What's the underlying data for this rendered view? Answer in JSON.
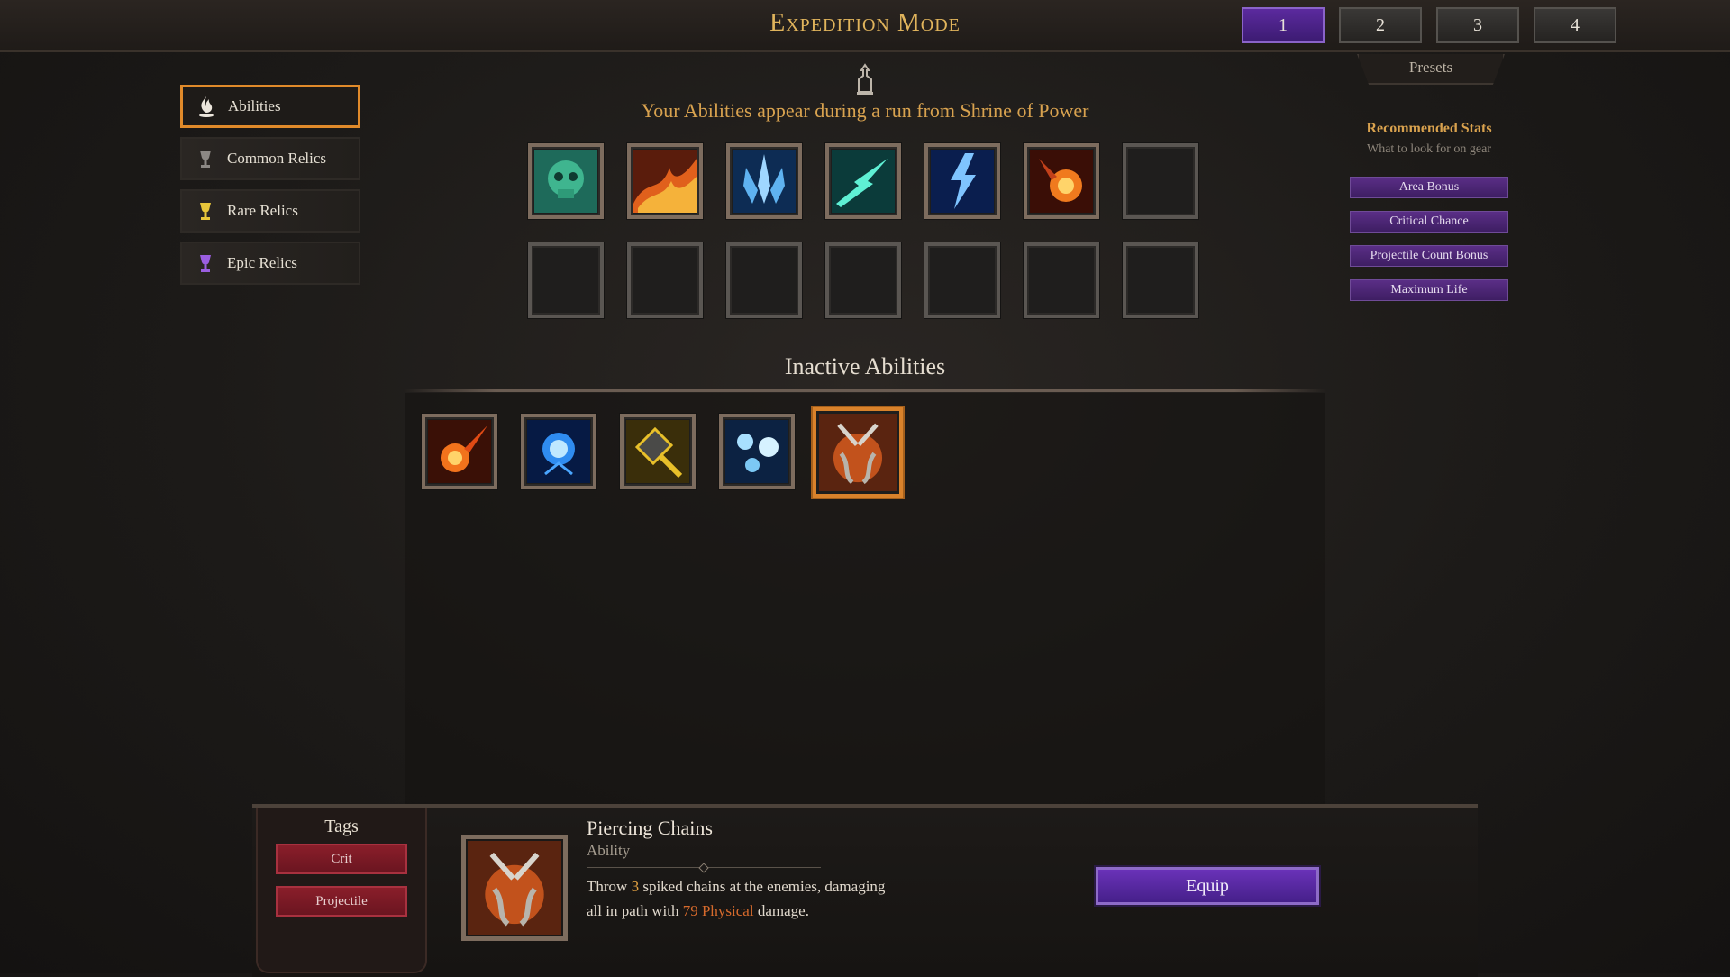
{
  "header": {
    "title": "Expedition Mode",
    "preset_buttons": [
      "1",
      "2",
      "3",
      "4"
    ],
    "active_preset": "1",
    "presets_label": "Presets"
  },
  "sidebar": {
    "items": [
      {
        "label": "Abilities",
        "icon": "ability-flame-icon",
        "active": true
      },
      {
        "label": "Common Relics",
        "icon": "common-relic-icon",
        "active": false
      },
      {
        "label": "Rare Relics",
        "icon": "rare-relic-icon",
        "active": false
      },
      {
        "label": "Epic Relics",
        "icon": "epic-relic-icon",
        "active": false
      }
    ]
  },
  "shrine": {
    "icon": "shrine-icon",
    "subtitle": "Your Abilities appear during a run from Shrine of Power"
  },
  "active_slots": {
    "row1": [
      "poison-skull-ability",
      "flame-wave-ability",
      "ice-crystal-ability",
      "lightning-slash-ability",
      "lightning-storm-ability",
      "fireball-ability",
      "empty"
    ],
    "row2": [
      "empty",
      "empty",
      "empty",
      "empty",
      "empty",
      "empty",
      "empty"
    ]
  },
  "inactive": {
    "title": "Inactive Abilities",
    "items": [
      "meteor-ability",
      "arcane-orb-ability",
      "hammer-ability",
      "frost-orbs-ability",
      "piercing-chains-ability"
    ],
    "selected_index": 4
  },
  "recommended": {
    "title": "Recommended Stats",
    "subtitle": "What to look for on gear",
    "stats": [
      "Area Bonus",
      "Critical Chance",
      "Projectile Count Bonus",
      "Maximum Life"
    ]
  },
  "tags": {
    "title": "Tags",
    "items": [
      "Crit",
      "Projectile"
    ]
  },
  "detail": {
    "name": "Piercing Chains",
    "type": "Ability",
    "desc_1": "Throw ",
    "desc_num": "3",
    "desc_2": " spiked chains at the enemies, damaging all in path with ",
    "desc_dmg": "79 Physical",
    "desc_3": " damage.",
    "icon": "piercing-chains-icon"
  },
  "equip_label": "Equip",
  "colors": {
    "accent_gold": "#e0b45c",
    "active_purple": "#5b2a9e",
    "selected_orange": "#d9822b",
    "tag_red": "#8a1e2a"
  }
}
